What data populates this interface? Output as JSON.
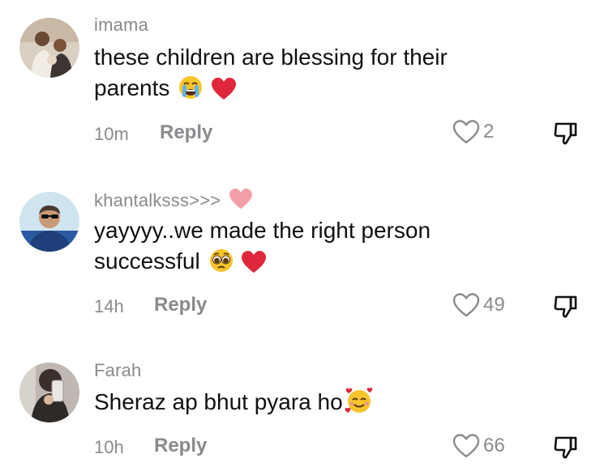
{
  "comments": [
    {
      "username": "imama",
      "text_line1": "these children are blessing for their",
      "text_line2": "parents",
      "time": "10m",
      "reply": "Reply",
      "likes": "2",
      "emojis": [
        "crying-face",
        "red-heart"
      ]
    },
    {
      "username": "khantalksss>>>",
      "text_line1": "yayyyy..we made the right person",
      "text_line2": "successful",
      "time": "14h",
      "reply": "Reply",
      "likes": "49",
      "emojis": [
        "pleading-face",
        "red-heart"
      ],
      "username_emoji": "pink-heart"
    },
    {
      "username": "Farah",
      "text_line1": "Sheraz ap bhut pyara ho",
      "time": "10h",
      "reply": "Reply",
      "likes": "66",
      "emojis": [
        "smiling-face-with-hearts"
      ]
    }
  ],
  "colors": {
    "meta_gray": "#8a8a8f",
    "heart_red": "#e0263a",
    "heart_pink": "#f2a0a8",
    "emoji_yellow": "#f7c52b"
  }
}
